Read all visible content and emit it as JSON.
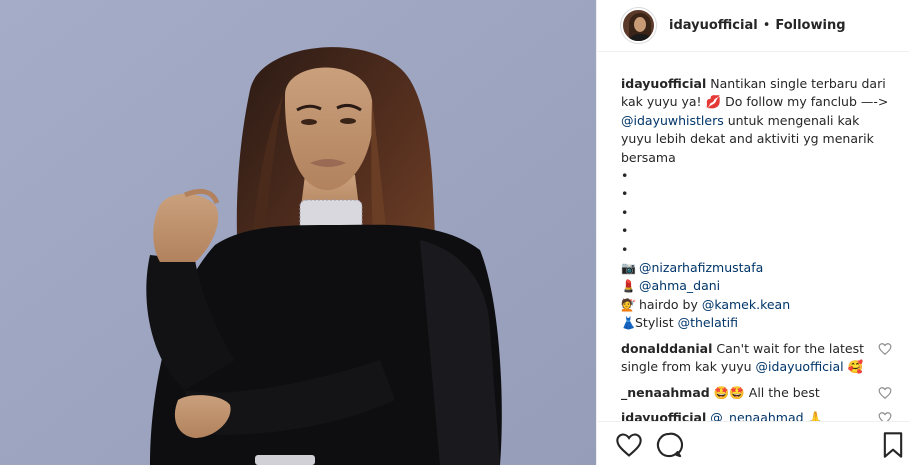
{
  "post": {
    "photo_alt": "",
    "username": "idayuofficial",
    "separator": "•",
    "follow_status": "Following"
  },
  "caption": {
    "username": "idayuofficial",
    "text_1": "Nantikan single terbaru dari kak yuyu ya! 💋 Do follow my fanclub —-> ",
    "mention_1": "@idayuwhistlers",
    "text_2": " untuk mengenali kak yuyu lebih dekat and aktiviti yg menarik bersama",
    "bullets": [
      "•",
      "•",
      "•",
      "•",
      "•"
    ],
    "credits": [
      {
        "icon": "📷",
        "icon_name": "camera-icon",
        "prefix": " ",
        "mention": "@nizarhafizmustafa"
      },
      {
        "icon": "💄",
        "icon_name": "lipstick-icon",
        "prefix": " ",
        "mention": "@ahma_dani"
      },
      {
        "icon": "💇",
        "icon_name": "haircut-icon",
        "prefix": " hairdo by ",
        "mention": "@kamek.kean"
      },
      {
        "icon": "👗",
        "icon_name": "dress-icon",
        "prefix": "Stylist ",
        "mention": "@thelatifi"
      }
    ]
  },
  "comments": [
    {
      "username": "donalddanial",
      "text": " Can't wait for the latest single from kak yuyu ",
      "mention": "@idayuofficial",
      "tail": " 🥰"
    },
    {
      "username": "_nenaahmad",
      "text": " 🤩🤩 All the best",
      "mention": "",
      "tail": ""
    },
    {
      "username": "idayuofficial",
      "text": " ",
      "mention": "@_nenaahmad",
      "tail": " 🙏"
    }
  ],
  "colors": {
    "photo_background": "#9ea6c3",
    "mention": "#003569",
    "text": "#262626",
    "border": "#efefef"
  }
}
